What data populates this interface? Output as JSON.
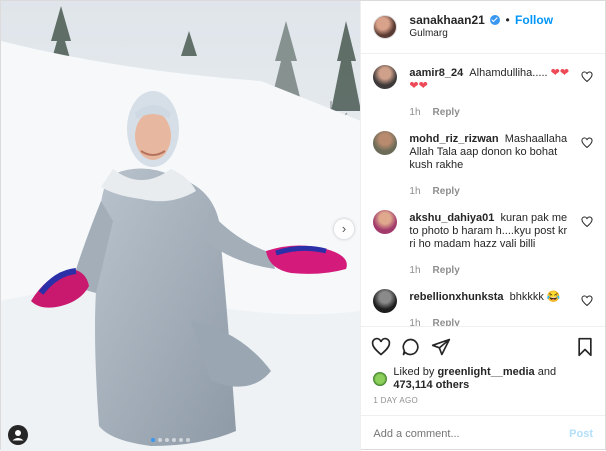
{
  "post": {
    "header": {
      "username": "sanakhaan21",
      "separator": "•",
      "follow_label": "Follow",
      "location": "Gulmarg",
      "verified_icon": "verified-badge-icon"
    },
    "comments": [
      {
        "user": "aamir8_24",
        "text": "Alhamdulliha.....",
        "emoji": "❤❤❤❤",
        "time": "1h",
        "reply": "Reply"
      },
      {
        "user": "mohd_riz_rizwan",
        "text": "Mashaallaha Allah Tala aap donon ko bohat kush rakhe",
        "emoji": "",
        "time": "1h",
        "reply": "Reply"
      },
      {
        "user": "akshu_dahiya01",
        "text": "kuran pak me to photo b haram h....kyu post kr ri ho madam hazz vali billi",
        "emoji": "",
        "time": "1h",
        "reply": "Reply"
      },
      {
        "user": "rebellionxhunksta",
        "text": "bhkkkk",
        "emoji": "😂",
        "time": "1h",
        "reply": "Reply"
      }
    ],
    "likes": {
      "prefix": "Liked by",
      "user": "greenlight__media",
      "conj": "and",
      "count": "473,114 others"
    },
    "timestamp": "1 DAY AGO",
    "add_comment": {
      "placeholder": "Add a comment...",
      "post_label": "Post"
    },
    "icons": {
      "like": "heart-icon",
      "comment": "comment-icon",
      "share": "share-icon",
      "save": "bookmark-icon",
      "next": "chevron-right-icon",
      "tag": "person-tag-icon"
    },
    "colors": {
      "accent": "#0095f6",
      "heart": "#ed4956",
      "muted": "#8e8e8e"
    },
    "carousel": {
      "total_slides": 6,
      "active_slide": 1
    }
  }
}
